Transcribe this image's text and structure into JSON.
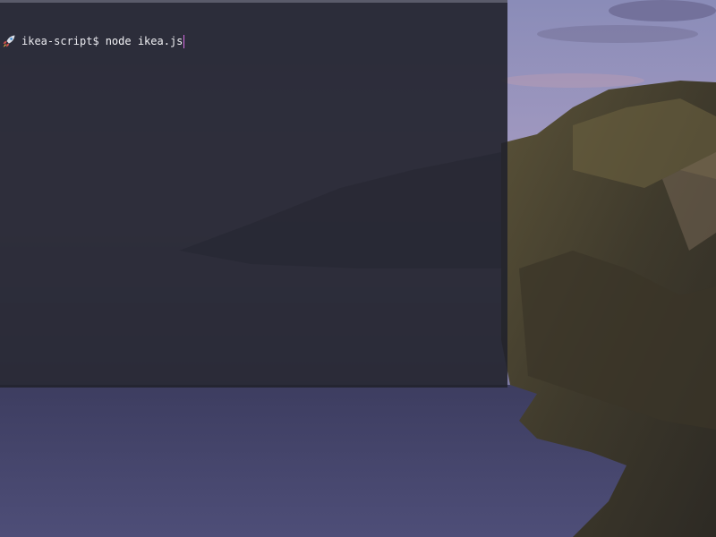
{
  "terminal": {
    "prompt": "ikea-script$",
    "command": "node ikea.js",
    "prompt_icon": "rocket-icon"
  },
  "colors": {
    "terminal_bg": "#21222c",
    "text": "#e9e9ee",
    "cursor": "#d46be0",
    "sky": "#7f7fa8",
    "sea": "#4a4a70",
    "cliff": "#4a4134"
  }
}
